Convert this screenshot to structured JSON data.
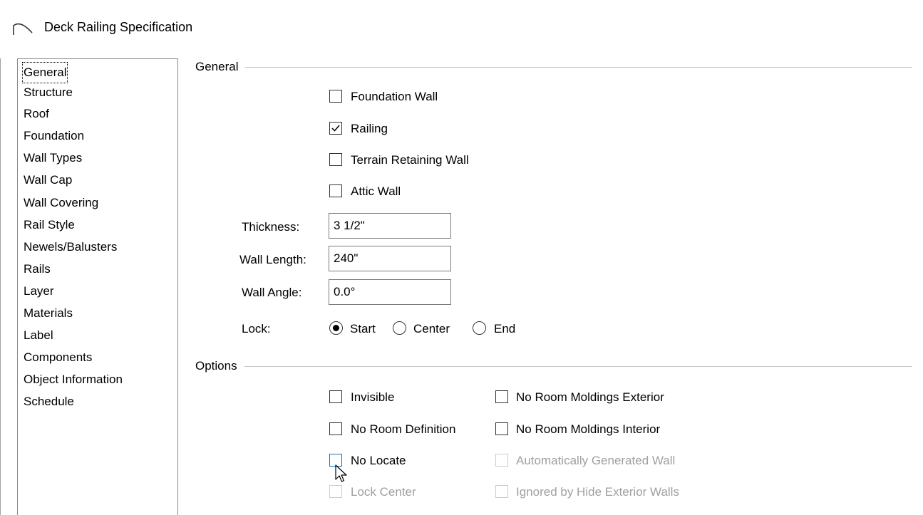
{
  "window": {
    "title": "Deck Railing Specification"
  },
  "sidebar": {
    "items": [
      {
        "label": "General",
        "selected": true
      },
      {
        "label": "Structure"
      },
      {
        "label": "Roof"
      },
      {
        "label": "Foundation"
      },
      {
        "label": "Wall Types"
      },
      {
        "label": "Wall Cap"
      },
      {
        "label": "Wall Covering"
      },
      {
        "label": "Rail Style"
      },
      {
        "label": "Newels/Balusters"
      },
      {
        "label": "Rails"
      },
      {
        "label": "Layer"
      },
      {
        "label": "Materials"
      },
      {
        "label": "Label"
      },
      {
        "label": "Components"
      },
      {
        "label": "Object Information"
      },
      {
        "label": "Schedule"
      }
    ]
  },
  "general": {
    "heading": "General",
    "foundation_wall": {
      "label": "Foundation Wall",
      "checked": false
    },
    "railing": {
      "label": "Railing",
      "checked": true
    },
    "terrain_retaining_wall": {
      "label": "Terrain Retaining Wall",
      "checked": false
    },
    "attic_wall": {
      "label": "Attic Wall",
      "checked": false
    },
    "thickness": {
      "label": "Thickness:",
      "value": "3 1/2\""
    },
    "wall_length": {
      "label": "Wall Length:",
      "value": "240\""
    },
    "wall_angle": {
      "label": "Wall Angle:",
      "value": "0.0°"
    },
    "lock": {
      "label": "Lock:",
      "options": [
        "Start",
        "Center",
        "End"
      ],
      "selected": "Start"
    }
  },
  "options": {
    "heading": "Options",
    "invisible": {
      "label": "Invisible",
      "checked": false
    },
    "no_room_definition": {
      "label": "No Room Definition",
      "checked": false
    },
    "no_locate": {
      "label": "No Locate",
      "checked": false
    },
    "lock_center": {
      "label": "Lock Center",
      "checked": false,
      "disabled": true
    },
    "no_room_moldings_exterior": {
      "label": "No Room Moldings Exterior",
      "checked": false
    },
    "no_room_moldings_interior": {
      "label": "No Room Moldings Interior",
      "checked": false
    },
    "automatically_generated_wall": {
      "label": "Automatically Generated Wall",
      "checked": false,
      "disabled": true
    },
    "ignored_by_hide_exterior_walls": {
      "label": "Ignored by Hide Exterior Walls",
      "checked": false,
      "disabled": true
    }
  },
  "colors": {
    "accent": "#0078d7",
    "disabled_text": "#a0a0a0",
    "list_border": "#828790"
  }
}
